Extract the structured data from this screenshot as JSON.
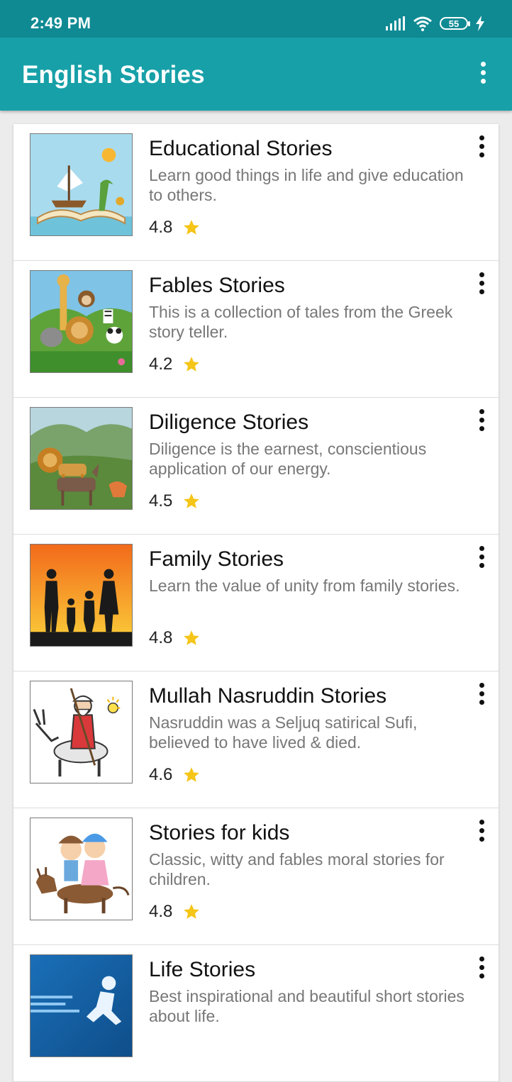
{
  "status_bar": {
    "time": "2:49 PM",
    "battery": "55",
    "icons": [
      "signal-icon",
      "wifi-icon",
      "battery-icon",
      "charging-icon"
    ]
  },
  "app_bar": {
    "title": "English Stories",
    "menu_icon": "more-vert-icon"
  },
  "colors": {
    "status_bar": "#0f8a93",
    "app_bar": "#17a0a8",
    "star": "#f5c518"
  },
  "stories": [
    {
      "title": "Educational Stories",
      "description": "Learn good things in life and give education to others.",
      "rating": "4.8",
      "rating_value": 4.8
    },
    {
      "title": "Fables Stories",
      "description": "This is a collection of tales from the Greek story teller.",
      "rating": "4.2",
      "rating_value": 4.2
    },
    {
      "title": "Diligence Stories",
      "description": "Diligence is the earnest, conscientious application of our energy.",
      "rating": "4.5",
      "rating_value": 4.5
    },
    {
      "title": "Family Stories",
      "description": "Learn the value of unity from family stories.",
      "rating": "4.8",
      "rating_value": 4.8
    },
    {
      "title": "Mullah Nasruddin Stories",
      "description": "Nasruddin was a Seljuq satirical Sufi, believed to have lived & died.",
      "rating": "4.6",
      "rating_value": 4.6
    },
    {
      "title": "Stories for kids",
      "description": "Classic, witty and fables moral stories for children.",
      "rating": "4.8",
      "rating_value": 4.8
    },
    {
      "title": "Life Stories",
      "description": "Best inspirational and beautiful short stories about life.",
      "rating": "",
      "rating_value": null
    }
  ]
}
